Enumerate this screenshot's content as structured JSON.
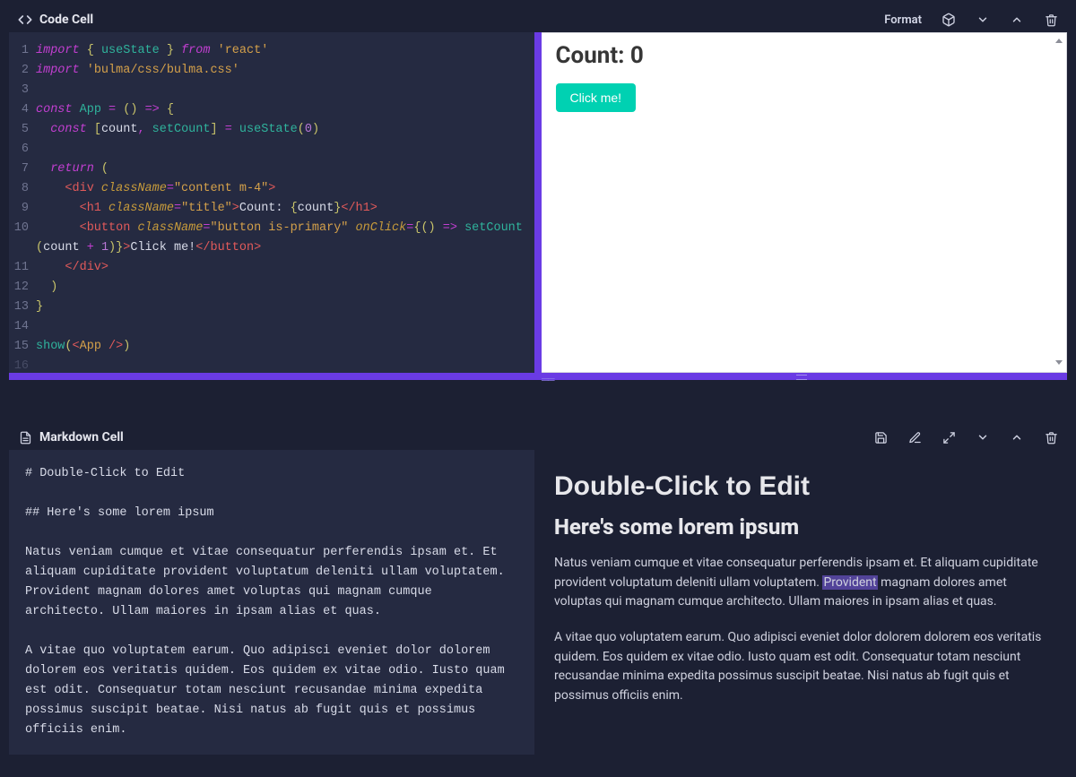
{
  "code_cell": {
    "title": "Code Cell",
    "toolbar": {
      "format": "Format"
    },
    "code_lines": [
      "import { useState } from 'react'",
      "import 'bulma/css/bulma.css'",
      "",
      "const App = () => {",
      "  const [count, setCount] = useState(0)",
      "",
      "  return (",
      "    <div className=\"content m-4\">",
      "      <h1 className=\"title\">Count: {count}</h1>",
      "      <button className=\"button is-primary\" onClick={() => setCount(count + 1)}>Click me!</button>",
      "    </div>",
      "  )",
      "}",
      "",
      "show(<App />)"
    ],
    "preview": {
      "heading": "Count: 0",
      "button_label": "Click me!"
    }
  },
  "markdown_cell": {
    "title": "Markdown Cell",
    "source": "# Double-Click to Edit\n\n## Here's some lorem ipsum\n\nNatus veniam cumque et vitae consequatur perferendis ipsam et. Et aliquam cupiditate provident voluptatum deleniti ullam voluptatem. Provident magnam dolores amet voluptas qui magnam cumque architecto. Ullam maiores in ipsam alias et quas.\n\nA vitae quo voluptatem earum. Quo adipisci eveniet dolor dolorem dolorem eos veritatis quidem. Eos quidem ex vitae odio. Iusto quam est odit. Consequatur totam nesciunt recusandae minima expedita possimus suscipit beatae. Nisi natus ab fugit quis et possimus officiis enim.",
    "render": {
      "h1": "Double-Click to Edit",
      "h2": "Here's some lorem ipsum",
      "p1_before": "Natus veniam cumque et vitae consequatur perferendis ipsam et. Et aliquam cupiditate provident voluptatum deleniti ullam voluptatem. ",
      "p1_highlight": "Provident",
      "p1_after": " magnam dolores amet voluptas qui magnam cumque architecto. Ullam maiores in ipsam alias et quas.",
      "p2": "A vitae quo voluptatem earum. Quo adipisci eveniet dolor dolorem dolorem eos veritatis quidem. Eos quidem ex vitae odio. Iusto quam est odit. Consequatur totam nesciunt recusandae minima expedita possimus suscipit beatae. Nisi natus ab fugit quis et possimus officiis enim."
    }
  }
}
